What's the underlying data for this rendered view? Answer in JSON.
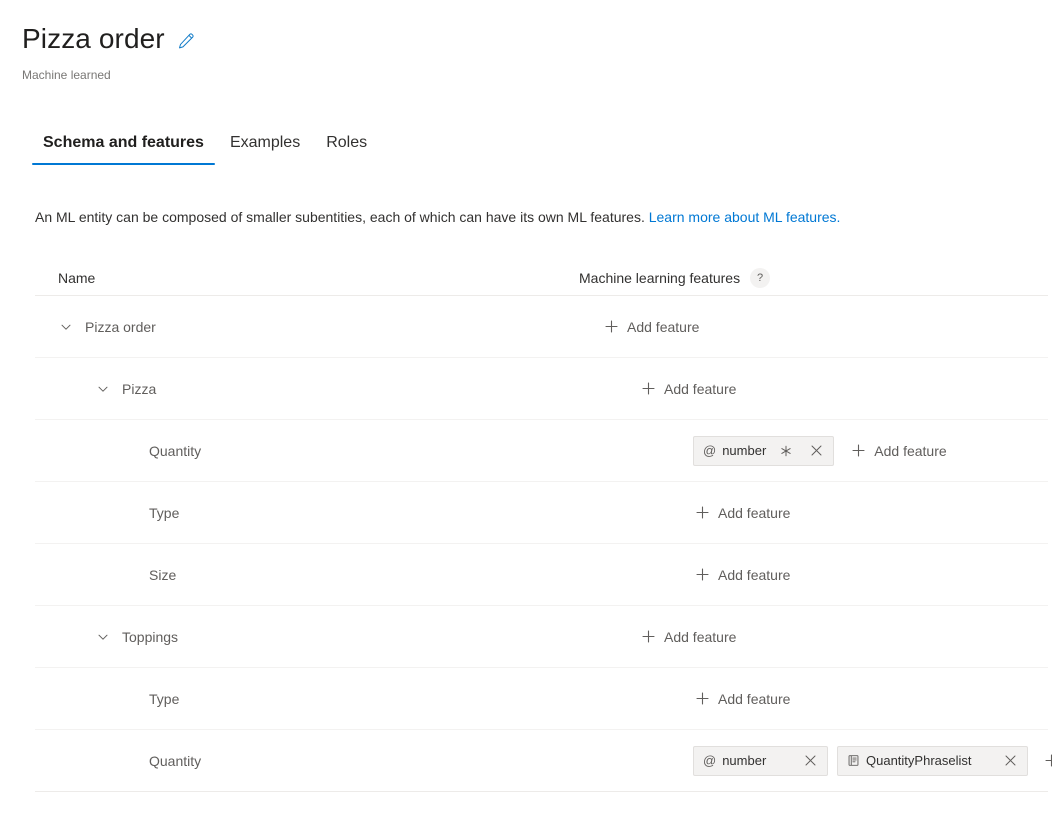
{
  "header": {
    "title": "Pizza order",
    "subtitle": "Machine learned",
    "edit_icon": "pencil-icon",
    "accent_color": "#0078d4"
  },
  "tabs": [
    {
      "label": "Schema and features",
      "active": true
    },
    {
      "label": "Examples",
      "active": false
    },
    {
      "label": "Roles",
      "active": false
    }
  ],
  "description": {
    "text": "An ML entity can be composed of smaller subentities, each of which can have its own ML features.",
    "link_text": "Learn more about ML features."
  },
  "table": {
    "columns": {
      "name": "Name",
      "features": "Machine learning features",
      "help_badge": "?"
    },
    "add_feature_label": "Add feature",
    "rows": [
      {
        "name": "Pizza order",
        "level": 0,
        "expandable": true,
        "expanded": true,
        "features": []
      },
      {
        "name": "Pizza",
        "level": 1,
        "expandable": true,
        "expanded": true,
        "features": []
      },
      {
        "name": "Quantity",
        "level": 2,
        "expandable": false,
        "features": [
          {
            "label": "number",
            "prefix_icon": "at-icon",
            "prefix": "@",
            "required": true,
            "removable": true
          }
        ]
      },
      {
        "name": "Type",
        "level": 2,
        "expandable": false,
        "features": []
      },
      {
        "name": "Size",
        "level": 2,
        "expandable": false,
        "features": []
      },
      {
        "name": "Toppings",
        "level": 1,
        "expandable": true,
        "expanded": true,
        "features": []
      },
      {
        "name": "Type",
        "level": 2,
        "expandable": false,
        "features": []
      },
      {
        "name": "Quantity",
        "level": 2,
        "expandable": false,
        "features": [
          {
            "label": "number",
            "prefix_icon": "at-icon",
            "prefix": "@",
            "required": false,
            "removable": true
          },
          {
            "label": "QuantityPhraselist",
            "prefix_icon": "phraselist-icon",
            "prefix": "",
            "required": false,
            "removable": true
          }
        ]
      }
    ]
  }
}
